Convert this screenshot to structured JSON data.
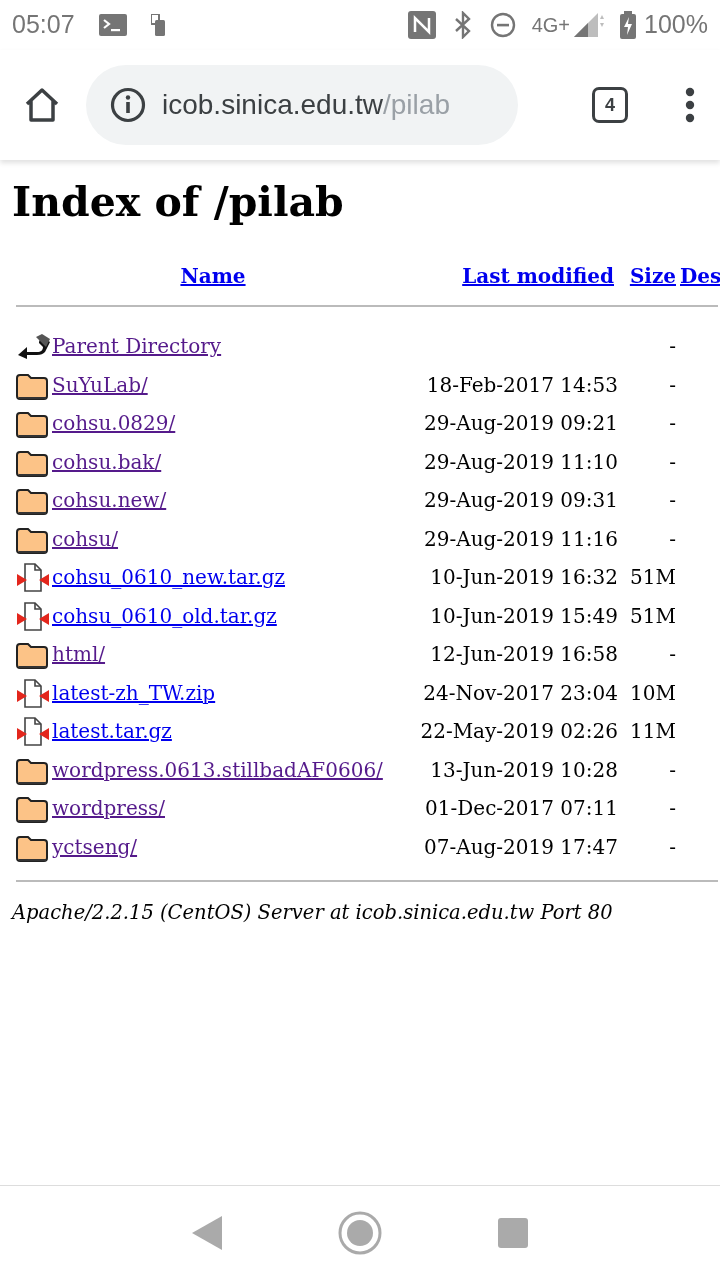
{
  "status_bar": {
    "time": "05:07",
    "network": "4G+",
    "battery": "100%"
  },
  "browser": {
    "url_host": "icob.sinica.edu.tw",
    "url_path": "/pilab",
    "tab_count": "4"
  },
  "page": {
    "title": "Index of /pilab",
    "columns": [
      "Name",
      "Last modified",
      "Size",
      "Des"
    ],
    "rows": [
      {
        "kind": "back",
        "name": "Parent Directory",
        "modified": "",
        "size": "-",
        "visited": true
      },
      {
        "kind": "folder",
        "name": "SuYuLab/",
        "modified": "18-Feb-2017 14:53",
        "size": "-",
        "visited": true
      },
      {
        "kind": "folder",
        "name": "cohsu.0829/",
        "modified": "29-Aug-2019 09:21",
        "size": "-",
        "visited": true
      },
      {
        "kind": "folder",
        "name": "cohsu.bak/",
        "modified": "29-Aug-2019 11:10",
        "size": "-",
        "visited": true
      },
      {
        "kind": "folder",
        "name": "cohsu.new/",
        "modified": "29-Aug-2019 09:31",
        "size": "-",
        "visited": true
      },
      {
        "kind": "folder",
        "name": "cohsu/",
        "modified": "29-Aug-2019 11:16",
        "size": "-",
        "visited": true
      },
      {
        "kind": "archive",
        "name": "cohsu_0610_new.tar.gz",
        "modified": "10-Jun-2019 16:32",
        "size": "51M",
        "visited": false
      },
      {
        "kind": "archive",
        "name": "cohsu_0610_old.tar.gz",
        "modified": "10-Jun-2019 15:49",
        "size": "51M",
        "visited": false
      },
      {
        "kind": "folder",
        "name": "html/",
        "modified": "12-Jun-2019 16:58",
        "size": "-",
        "visited": true
      },
      {
        "kind": "archive",
        "name": "latest-zh_TW.zip",
        "modified": "24-Nov-2017 23:04",
        "size": "10M",
        "visited": false
      },
      {
        "kind": "archive",
        "name": "latest.tar.gz",
        "modified": "22-May-2019 02:26",
        "size": "11M",
        "visited": false
      },
      {
        "kind": "folder",
        "name": "wordpress.0613.stillbadAF0606/",
        "modified": "13-Jun-2019 10:28",
        "size": "-",
        "visited": true
      },
      {
        "kind": "folder",
        "name": "wordpress/",
        "modified": "01-Dec-2017 07:11",
        "size": "-",
        "visited": true
      },
      {
        "kind": "folder",
        "name": "yctseng/",
        "modified": "07-Aug-2019 17:47",
        "size": "-",
        "visited": true
      }
    ],
    "footer": "Apache/2.2.15 (CentOS) Server at icob.sinica.edu.tw Port 80"
  }
}
